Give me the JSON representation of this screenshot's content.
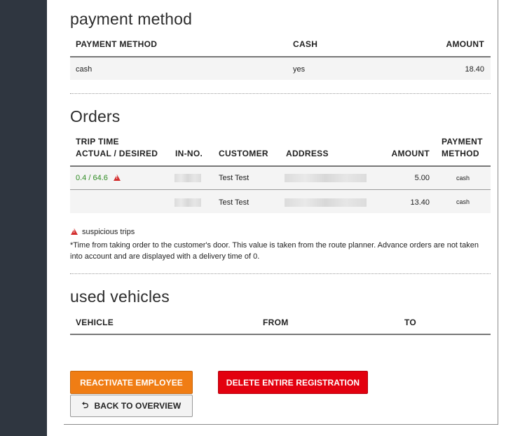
{
  "payment": {
    "title": "payment method",
    "headers": [
      "PAYMENT METHOD",
      "CASH",
      "AMOUNT"
    ],
    "row": {
      "method": "cash",
      "cash": "yes",
      "amount": "18.40"
    }
  },
  "orders": {
    "title": "Orders",
    "headers": {
      "trip_time_line1": "TRIP TIME",
      "trip_time_line2": "ACTUAL / DESIRED",
      "in_no": "IN-NO.",
      "customer": "CUSTOMER",
      "address": "ADDRESS",
      "amount": "AMOUNT",
      "payment_line1": "PAYMENT",
      "payment_line2": "METHOD"
    },
    "rows": [
      {
        "trip_time": "0.4 / 64.6",
        "customer": "Test Test",
        "amount": "5.00",
        "method": "cash"
      },
      {
        "trip_time": "",
        "customer": "Test Test",
        "amount": "13.40",
        "method": "cash"
      }
    ],
    "legend": "suspicious trips",
    "note": "*Time from taking order to the customer's door. This value is taken from the route planner. Advance orders are not taken into account and are displayed with a delivery time of 0."
  },
  "vehicles": {
    "title": "used vehicles",
    "headers": [
      "VEHICLE",
      "FROM",
      "TO"
    ]
  },
  "buttons": {
    "reactivate": "REACTIVATE EMPLOYEE",
    "delete": "DELETE ENTIRE REGISTRATION",
    "back": "BACK TO OVERVIEW"
  },
  "colors": {
    "accent_orange": "#f07d14",
    "danger_red": "#e3000f",
    "trip_time_green": "#2e8b22",
    "warning_red": "#d32f2f"
  },
  "icons": [
    "warning-triangle-icon",
    "back-arrow-icon"
  ]
}
